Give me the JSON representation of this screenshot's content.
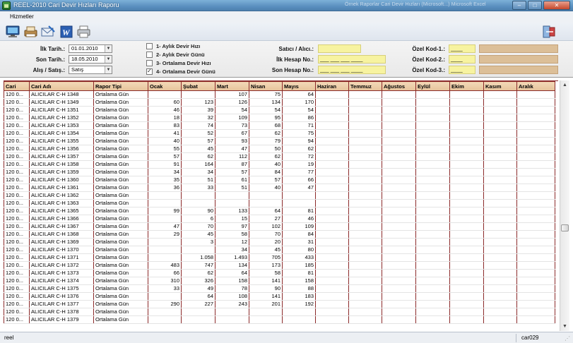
{
  "window": {
    "title": "REEL-2010 Cari Devir Hızları Raporu",
    "ghost_tabs": "Örnek Raporlar   Cari Devir Hızları (Microsoft...)   Microsoft Excel",
    "minimize": "–",
    "maximize": "□",
    "close": "✕"
  },
  "menu": {
    "hizmetler": "Hizmetler"
  },
  "filters": {
    "ilk_tarih_label": "İlk Tarih.:",
    "ilk_tarih": "01.01.2010",
    "son_tarih_label": "Son Tarih.:",
    "son_tarih": "18.05.2010",
    "alis_satis_label": "Alış / Satış.:",
    "alis_satis": "Satış",
    "options": [
      {
        "label": "1- Aylık Devir Hızı",
        "checked": false
      },
      {
        "label": "2- Aylık Devir Günü",
        "checked": false
      },
      {
        "label": "3- Ortalama Devir Hızı",
        "checked": false
      },
      {
        "label": "4- Ortalama Devir Günü",
        "checked": true
      }
    ],
    "satici_label": "Satıcı / Alıcı.:",
    "ilk_hesap_label": "İlk Hesap No.:",
    "ilk_hesap": "___ ___ ___ ____",
    "son_hesap_label": "Son Hesap No.:",
    "son_hesap": "___ ___ ___ ____",
    "ozel1_label": "Özel Kod-1.:",
    "ozel2_label": "Özel Kod-2.:",
    "ozel3_label": "Özel Kod-3.:",
    "ozel_placeholder": "____"
  },
  "grid": {
    "columns": [
      "Cari",
      "Cari Adı",
      "Rapor Tipi",
      "Ocak",
      "Şubat",
      "Mart",
      "Nisan",
      "Mayıs",
      "Haziran",
      "Temmuz",
      "Ağustos",
      "Eylül",
      "Ekim",
      "Kasım",
      "Aralık"
    ],
    "rows": [
      [
        "120 0...",
        "ALICILAR C-H 1348",
        "Ortalama Gün",
        "",
        "",
        "107",
        "75",
        "64"
      ],
      [
        "120 0...",
        "ALICILAR C-H 1349",
        "Ortalama Gün",
        "60",
        "123",
        "126",
        "134",
        "170"
      ],
      [
        "120 0...",
        "ALICILAR C-H 1351",
        "Ortalama Gün",
        "46",
        "39",
        "54",
        "54",
        "54"
      ],
      [
        "120 0...",
        "ALICILAR C-H 1352",
        "Ortalama Gün",
        "18",
        "32",
        "109",
        "95",
        "86"
      ],
      [
        "120 0...",
        "ALICILAR C-H 1353",
        "Ortalama Gün",
        "83",
        "74",
        "73",
        "68",
        "71"
      ],
      [
        "120 0...",
        "ALICILAR C-H 1354",
        "Ortalama Gün",
        "41",
        "52",
        "67",
        "62",
        "75"
      ],
      [
        "120 0...",
        "ALICILAR C-H 1355",
        "Ortalama Gün",
        "40",
        "57",
        "93",
        "79",
        "94"
      ],
      [
        "120 0...",
        "ALICILAR C-H 1356",
        "Ortalama Gün",
        "55",
        "45",
        "47",
        "50",
        "62"
      ],
      [
        "120 0...",
        "ALICILAR C-H 1357",
        "Ortalama Gün",
        "57",
        "62",
        "112",
        "62",
        "72"
      ],
      [
        "120 0...",
        "ALICILAR C-H 1358",
        "Ortalama Gün",
        "91",
        "164",
        "87",
        "40",
        "19"
      ],
      [
        "120 0...",
        "ALICILAR C-H 1359",
        "Ortalama Gün",
        "34",
        "34",
        "57",
        "84",
        "77"
      ],
      [
        "120 0...",
        "ALICILAR C-H 1360",
        "Ortalama Gün",
        "35",
        "51",
        "61",
        "57",
        "66"
      ],
      [
        "120 0...",
        "ALICILAR C-H 1361",
        "Ortalama Gün",
        "36",
        "33",
        "51",
        "40",
        "47"
      ],
      [
        "120 0...",
        "ALICILAR C-H 1362",
        "Ortalama Gün",
        "",
        "",
        "",
        "",
        ""
      ],
      [
        "120 0...",
        "ALICILAR C-H 1363",
        "Ortalama Gün",
        "",
        "",
        "",
        "",
        ""
      ],
      [
        "120 0...",
        "ALICILAR C-H 1365",
        "Ortalama Gün",
        "99",
        "90",
        "133",
        "64",
        "81"
      ],
      [
        "120 0...",
        "ALICILAR C-H 1366",
        "Ortalama Gün",
        "",
        "6",
        "15",
        "27",
        "46"
      ],
      [
        "120 0...",
        "ALICILAR C-H 1367",
        "Ortalama Gün",
        "47",
        "70",
        "97",
        "102",
        "109"
      ],
      [
        "120 0...",
        "ALICILAR C-H 1368",
        "Ortalama Gün",
        "29",
        "45",
        "58",
        "70",
        "84"
      ],
      [
        "120 0...",
        "ALICILAR C-H 1369",
        "Ortalama Gün",
        "",
        "3",
        "12",
        "20",
        "31"
      ],
      [
        "120 0...",
        "ALICILAR C-H 1370",
        "Ortalama Gün",
        "",
        "",
        "34",
        "45",
        "80"
      ],
      [
        "120 0...",
        "ALICILAR C-H 1371",
        "Ortalama Gün",
        "",
        "1.058",
        "1.493",
        "705",
        "433"
      ],
      [
        "120 0...",
        "ALICILAR C-H 1372",
        "Ortalama Gün",
        "483",
        "747",
        "134",
        "173",
        "185"
      ],
      [
        "120 0...",
        "ALICILAR C-H 1373",
        "Ortalama Gün",
        "66",
        "62",
        "64",
        "58",
        "81"
      ],
      [
        "120 0...",
        "ALICILAR C-H 1374",
        "Ortalama Gün",
        "310",
        "326",
        "158",
        "141",
        "158"
      ],
      [
        "120 0...",
        "ALICILAR C-H 1375",
        "Ortalama Gün",
        "33",
        "49",
        "78",
        "90",
        "88"
      ],
      [
        "120 0...",
        "ALICILAR C-H 1376",
        "Ortalama Gün",
        "",
        "64",
        "108",
        "141",
        "183"
      ],
      [
        "120 0...",
        "ALICILAR C-H 1377",
        "Ortalama Gün",
        "290",
        "227",
        "243",
        "201",
        "192"
      ],
      [
        "120 0...",
        "ALICILAR C-H 1378",
        "Ortalama Gün",
        "",
        "",
        "",
        "",
        ""
      ],
      [
        "120 0...",
        "ALICILAR C-H 1379",
        "Ortalama Gün",
        "",
        "",
        "",
        "",
        ""
      ]
    ]
  },
  "scrollbar": {
    "up": "▲",
    "down": "▼"
  },
  "status": {
    "left": "reel",
    "right": "car029"
  }
}
